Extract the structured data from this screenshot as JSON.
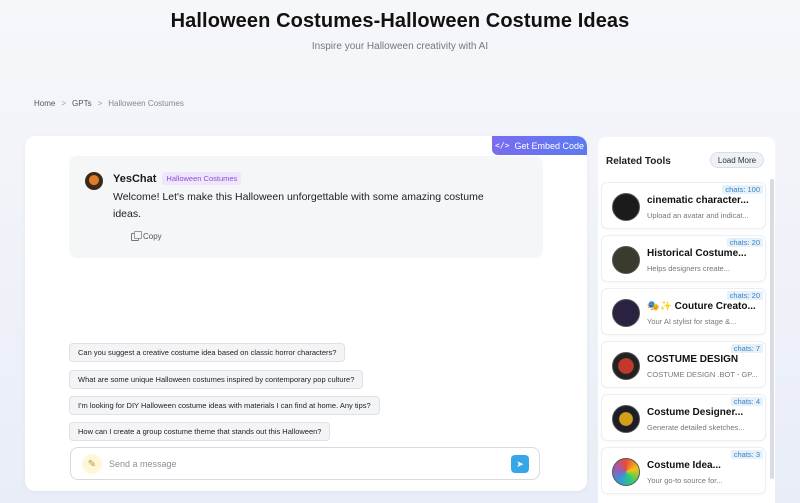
{
  "header": {
    "title": "Halloween Costumes-Halloween Costume Ideas",
    "subtitle": "Inspire your Halloween creativity with AI"
  },
  "breadcrumb": {
    "home": "Home",
    "sep": ">",
    "gpts": "GPTs",
    "current": "Halloween Costumes"
  },
  "chat": {
    "embed_label": "Get Embed Code",
    "embed_icon": "</>",
    "sender": "YesChat",
    "badge": "Halloween Costumes",
    "message": "Welcome! Let's make this Halloween unforgettable with some amazing costume ideas.",
    "copy_label": "Copy",
    "suggestions": [
      "Can you suggest a creative costume idea based on classic horror characters?",
      "What are some unique Halloween costumes inspired by contemporary pop culture?",
      "I'm looking for DIY Halloween costume ideas with materials I can find at home. Any tips?",
      "How can I create a group costume theme that stands out this Halloween?"
    ],
    "input_placeholder": "Send a message"
  },
  "related": {
    "title": "Related Tools",
    "load_more": "Load More",
    "tools": [
      {
        "chats": "chats: 100",
        "name": "cinematic character...",
        "desc": "Upload an avatar and indicat..."
      },
      {
        "chats": "chats: 20",
        "name": "Historical Costume...",
        "desc": "Helps designers create..."
      },
      {
        "chats": "chats: 20",
        "name": "🎭✨ Couture Creato...",
        "desc": "Your AI stylist for stage &..."
      },
      {
        "chats": "chats: 7",
        "name": "COSTUME DESIGN",
        "desc": "COSTUME DESIGN .BOT - GP..."
      },
      {
        "chats": "chats: 4",
        "name": "Costume Designer...",
        "desc": "Generate detailed sketches..."
      },
      {
        "chats": "chats: 3",
        "name": "Costume Idea...",
        "desc": "Your go-to source for..."
      }
    ]
  },
  "colors": {
    "embed_gradient_start": "#7b6cf0",
    "embed_gradient_end": "#5b7af0",
    "badge_text": "#8a4fd6",
    "chats_text": "#3b82c4",
    "send_button": "#35a7e6"
  }
}
